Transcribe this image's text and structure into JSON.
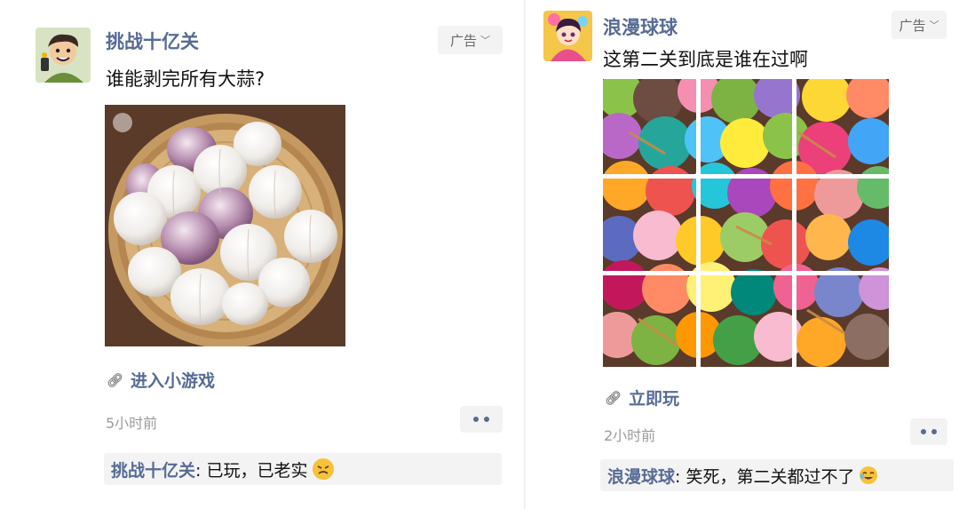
{
  "left_post": {
    "account_name": "挑战十亿关",
    "ad_label": "广告",
    "caption": "谁能剥完所有大蒜?",
    "link_label": "进入小游戏",
    "time": "5小时前",
    "comment_author": "挑战十亿关",
    "comment_text": ": 已玩，已老实",
    "comment_emoji": "persevering-face-icon"
  },
  "right_post": {
    "account_name": "浪漫球球",
    "ad_label": "广告",
    "caption": "这第二关到底是谁在过啊",
    "link_label": "立即玩",
    "time": "2小时前",
    "comment_author": "浪漫球球",
    "comment_text": ": 笑死，第二关都过不了",
    "comment_emoji": "crying-laughing-face-icon"
  },
  "colors": {
    "link_blue": "#576b95",
    "meta_gray": "#9b9b9b",
    "bg_gray": "#f3f3f3"
  }
}
